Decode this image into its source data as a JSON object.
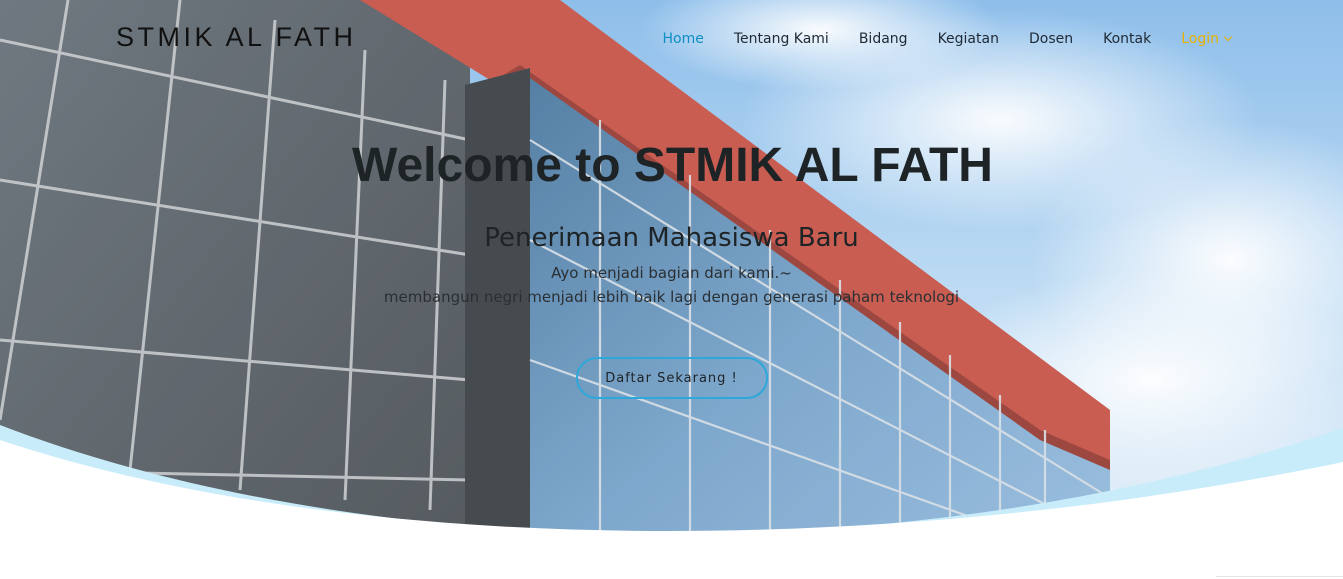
{
  "brand": {
    "name": "STMIK AL FATH"
  },
  "nav": {
    "items": [
      {
        "label": "Home",
        "active": true
      },
      {
        "label": "Tentang Kami",
        "active": false
      },
      {
        "label": "Bidang",
        "active": false
      },
      {
        "label": "Kegiatan",
        "active": false
      },
      {
        "label": "Dosen",
        "active": false
      },
      {
        "label": "Kontak",
        "active": false
      }
    ],
    "login": {
      "label": "Login",
      "icon": "chevron-down-icon"
    }
  },
  "hero": {
    "title": "Welcome to STMIK AL FATH",
    "subtitle": "Penerimaan Mahasiswa Baru",
    "line1": "Ayo menjadi bagian dari kami.~",
    "line2": "membangun negri menjadi lebih baik lagi dengan generasi paham teknologi",
    "cta_label": "Daftar Sekarang !"
  },
  "colors": {
    "accent": "#0d8fc4",
    "login": "#e8b100",
    "cta_border": "#2ea8d8",
    "wave": "#c8ecfa",
    "text": "#1e2326"
  }
}
